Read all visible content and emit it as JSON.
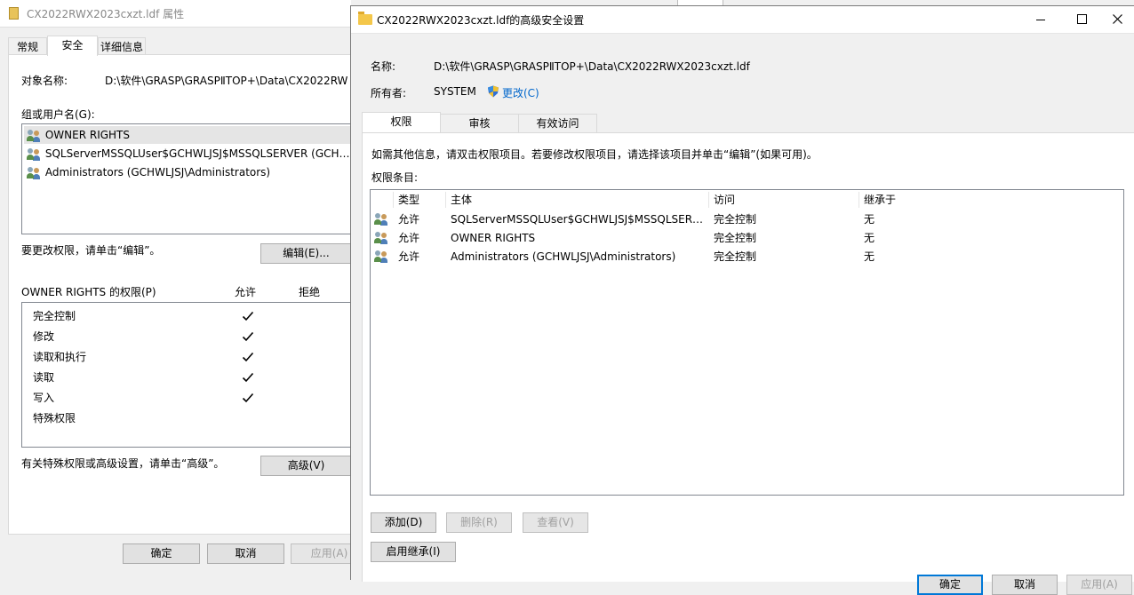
{
  "props": {
    "title": "CX2022RWX2023cxzt.ldf 属性",
    "tabs": [
      "常规",
      "安全",
      "详细信息"
    ],
    "object_label": "对象名称:",
    "object_value": "D:\\软件\\GRASP\\GRASPⅡTOP+\\Data\\CX2022RW",
    "group_label": "组或用户名(G):",
    "users": [
      "OWNER RIGHTS",
      "SQLServerMSSQLUser$GCHWLJSJ$MSSQLSERVER (GCH…",
      "Administrators (GCHWLJSJ\\Administrators)"
    ],
    "edit_hint": "要更改权限，请单击“编辑”。",
    "edit_button": "编辑(E)...",
    "perm_header": "OWNER RIGHTS 的权限(P)",
    "allow_header": "允许",
    "deny_header": "拒绝",
    "perms": [
      {
        "name": "完全控制",
        "allow": true
      },
      {
        "name": "修改",
        "allow": true
      },
      {
        "name": "读取和执行",
        "allow": true
      },
      {
        "name": "读取",
        "allow": true
      },
      {
        "name": "写入",
        "allow": true
      },
      {
        "name": "特殊权限",
        "allow": false
      }
    ],
    "adv_hint": "有关特殊权限或高级设置，请单击“高级”。",
    "adv_button": "高级(V)",
    "ok": "确定",
    "cancel": "取消",
    "apply": "应用(A)"
  },
  "adv": {
    "title": "CX2022RWX2023cxzt.ldf的高级安全设置",
    "name_label": "名称:",
    "name_value": "D:\\软件\\GRASP\\GRASPⅡTOP+\\Data\\CX2022RWX2023cxzt.ldf",
    "owner_label": "所有者:",
    "owner_value": "SYSTEM",
    "change_link": "更改(C)",
    "tabs": [
      "权限",
      "审核",
      "有效访问"
    ],
    "info": "如需其他信息，请双击权限项目。若要修改权限项目，请选择该项目并单击“编辑”(如果可用)。",
    "entries_label": "权限条目:",
    "columns": [
      "类型",
      "主体",
      "访问",
      "继承于"
    ],
    "rows": [
      {
        "type": "允许",
        "principal": "SQLServerMSSQLUser$GCHWLJSJ$MSSQLSER…",
        "access": "完全控制",
        "inherited": "无"
      },
      {
        "type": "允许",
        "principal": "OWNER RIGHTS",
        "access": "完全控制",
        "inherited": "无"
      },
      {
        "type": "允许",
        "principal": "Administrators (GCHWLJSJ\\Administrators)",
        "access": "完全控制",
        "inherited": "无"
      }
    ],
    "add_button": "添加(D)",
    "remove_button": "删除(R)",
    "view_button": "查看(V)",
    "inherit_button": "启用继承(I)",
    "ok": "确定",
    "cancel": "取消",
    "apply": "应用(A)"
  }
}
